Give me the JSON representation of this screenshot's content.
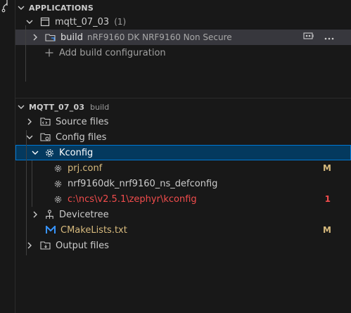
{
  "applications": {
    "title": "APPLICATIONS",
    "app_name": "mqtt_07_03",
    "app_count": "(1)",
    "build": {
      "label": "build",
      "desc": "nRF9160 DK NRF9160 Non Secure"
    },
    "add_build": "Add build configuration"
  },
  "project": {
    "title": "MQTT_07_03",
    "subtitle": "build",
    "items": {
      "source_files": "Source files",
      "config_files": "Config files",
      "kconfig": "Kconfig",
      "prj_conf": "prj.conf",
      "prj_conf_badge": "M",
      "defconfig": "nrf9160dk_nrf9160_ns_defconfig",
      "kconfig_path": "c:\\ncs\\v2.5.1\\zephyr\\kconfig",
      "kconfig_path_badge": "1",
      "devicetree": "Devicetree",
      "cmakelists": "CMakeLists.txt",
      "cmakelists_badge": "M",
      "output_files": "Output files"
    }
  },
  "colors": {
    "accent": "#0078d4",
    "modified": "#d7ba7d",
    "error": "#f14c4c",
    "selected_bg": "#04395e"
  }
}
